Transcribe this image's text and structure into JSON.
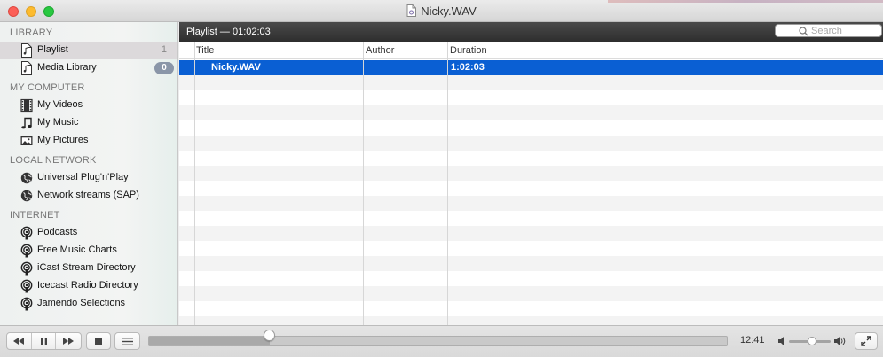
{
  "window": {
    "title": "Nicky.WAV"
  },
  "sidebar": {
    "sections": [
      {
        "heading": "LIBRARY",
        "items": [
          {
            "label": "Playlist",
            "icon": "playlist-icon",
            "badge": "1",
            "badge_style": "plain",
            "selected": true
          },
          {
            "label": "Media Library",
            "icon": "playlist-icon",
            "badge": "0",
            "badge_style": "pill",
            "selected": false
          }
        ]
      },
      {
        "heading": "MY COMPUTER",
        "items": [
          {
            "label": "My Videos",
            "icon": "film-icon"
          },
          {
            "label": "My Music",
            "icon": "music-note-icon"
          },
          {
            "label": "My Pictures",
            "icon": "picture-icon"
          }
        ]
      },
      {
        "heading": "LOCAL NETWORK",
        "items": [
          {
            "label": "Universal Plug'n'Play",
            "icon": "globe-icon"
          },
          {
            "label": "Network streams (SAP)",
            "icon": "globe-icon"
          }
        ]
      },
      {
        "heading": "INTERNET",
        "items": [
          {
            "label": "Podcasts",
            "icon": "podcast-icon"
          },
          {
            "label": "Free Music Charts",
            "icon": "podcast-icon"
          },
          {
            "label": "iCast Stream Directory",
            "icon": "podcast-icon"
          },
          {
            "label": "Icecast Radio Directory",
            "icon": "podcast-icon"
          },
          {
            "label": "Jamendo Selections",
            "icon": "podcast-icon"
          }
        ]
      }
    ]
  },
  "playlist": {
    "header": "Playlist — 01:02:03",
    "search_placeholder": "Search",
    "columns": [
      "Title",
      "Author",
      "Duration"
    ],
    "rows": [
      {
        "title": "Nicky.WAV",
        "author": "",
        "duration": "1:02:03",
        "selected": true
      }
    ]
  },
  "controls": {
    "elapsed": "12:41",
    "progress_fraction": 0.209,
    "volume_fraction": 0.55
  },
  "colors": {
    "selection": "#0a5fd3",
    "header_dark": "#3a3a3a",
    "badge": "#8a96a8"
  }
}
